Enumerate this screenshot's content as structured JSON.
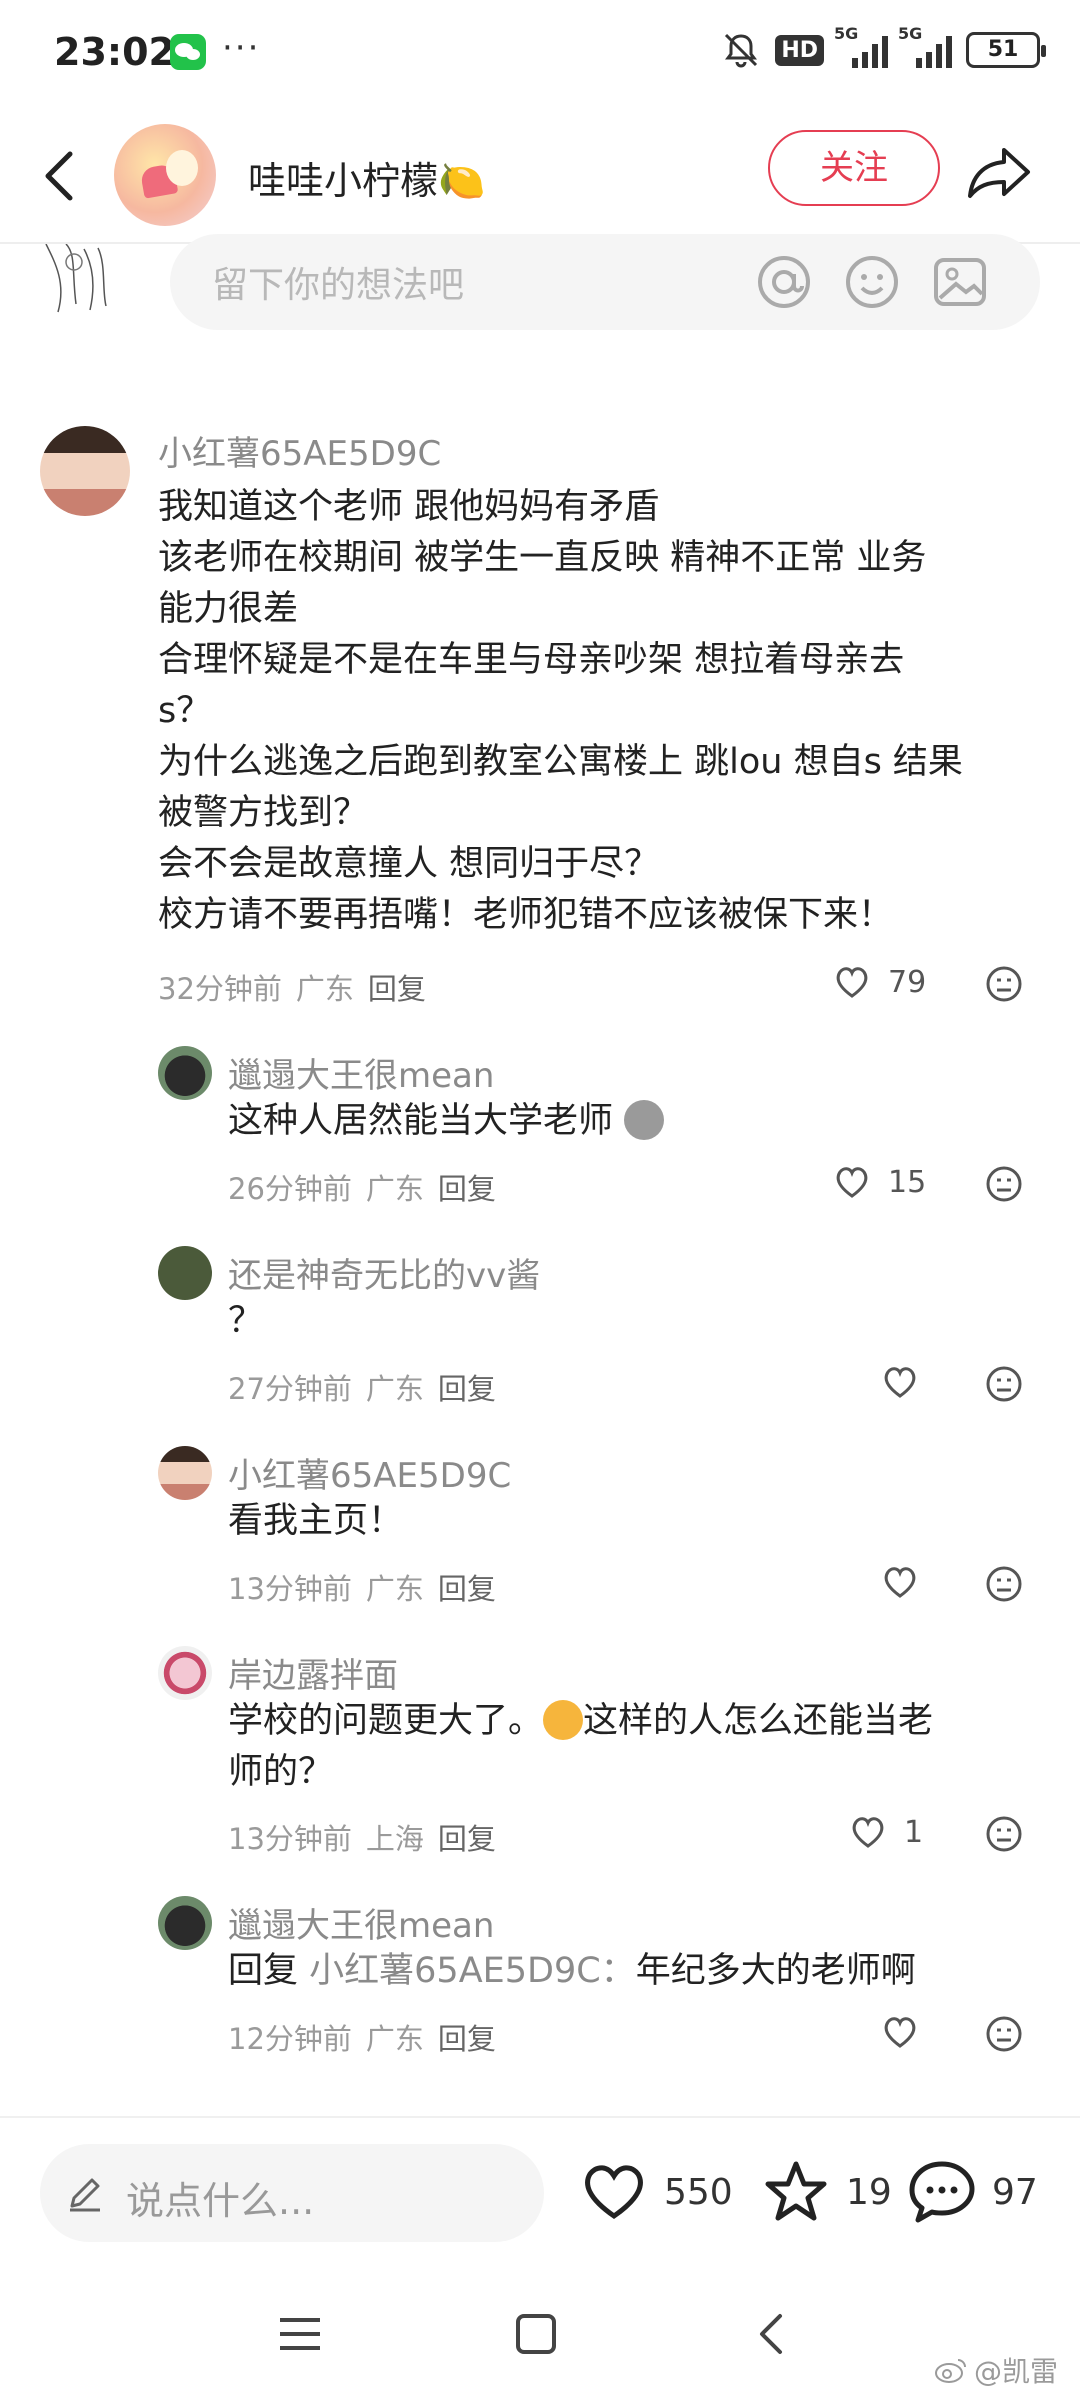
{
  "status_bar": {
    "time": "23:02",
    "dots": "···",
    "hd_label": "HD",
    "sig1_label": "5G",
    "sig2_label": "5G",
    "battery": "51"
  },
  "header": {
    "author_name": "哇哇小柠檬🍋",
    "follow_label": "关注"
  },
  "comment_input": {
    "placeholder": "留下你的想法吧"
  },
  "comments": [
    {
      "user": "小红薯65AE5D9C",
      "lines": [
        "我知道这个老师 跟他妈妈有矛盾",
        "该老师在校期间 被学生一直反映 精神不正常 业务",
        "能力很差",
        "合理怀疑是不是在车里与母亲吵架 想拉着母亲去",
        "s？",
        "为什么逃逸之后跑到教室公寓楼上 跳lou 想自s 结果",
        "被警方找到？",
        "会不会是故意撞人 想同归于尽？",
        "校方请不要再捂嘴！老师犯错不应该被保下来！"
      ],
      "time": "32分钟前",
      "location": "广东",
      "reply_label": "回复",
      "likes": "79"
    }
  ],
  "replies": [
    {
      "user": "邋遢大王很mean",
      "text": "这种人居然能当大学老师",
      "time": "26分钟前",
      "location": "广东",
      "reply_label": "回复",
      "likes": "15"
    },
    {
      "user": "还是神奇无比的vv酱",
      "text": "？",
      "time": "27分钟前",
      "location": "广东",
      "reply_label": "回复",
      "likes": ""
    },
    {
      "user": "小红薯65AE5D9C",
      "text": "看我主页！",
      "time": "13分钟前",
      "location": "广东",
      "reply_label": "回复",
      "likes": ""
    },
    {
      "user": "岸边露拌面",
      "text_line1_a": "学校的问题更大了。",
      "text_line1_b": "这样的人怎么还能当老",
      "text_line2": "师的？",
      "time": "13分钟前",
      "location": "上海",
      "reply_label": "回复",
      "likes": "1"
    },
    {
      "user": "邋遢大王很mean",
      "reply_prefix": "回复",
      "reply_to": "小红薯65AE5D9C：",
      "text": "年纪多大的老师啊",
      "time": "12分钟前",
      "location": "广东",
      "reply_label": "回复",
      "likes": ""
    }
  ],
  "bottom_bar": {
    "say_placeholder": "说点什么...",
    "likes": "550",
    "stars": "19",
    "comments": "97"
  },
  "watermark": "@凯雷",
  "colors": {
    "accent": "#e53e52",
    "meta_gray": "#9a9a9a"
  }
}
